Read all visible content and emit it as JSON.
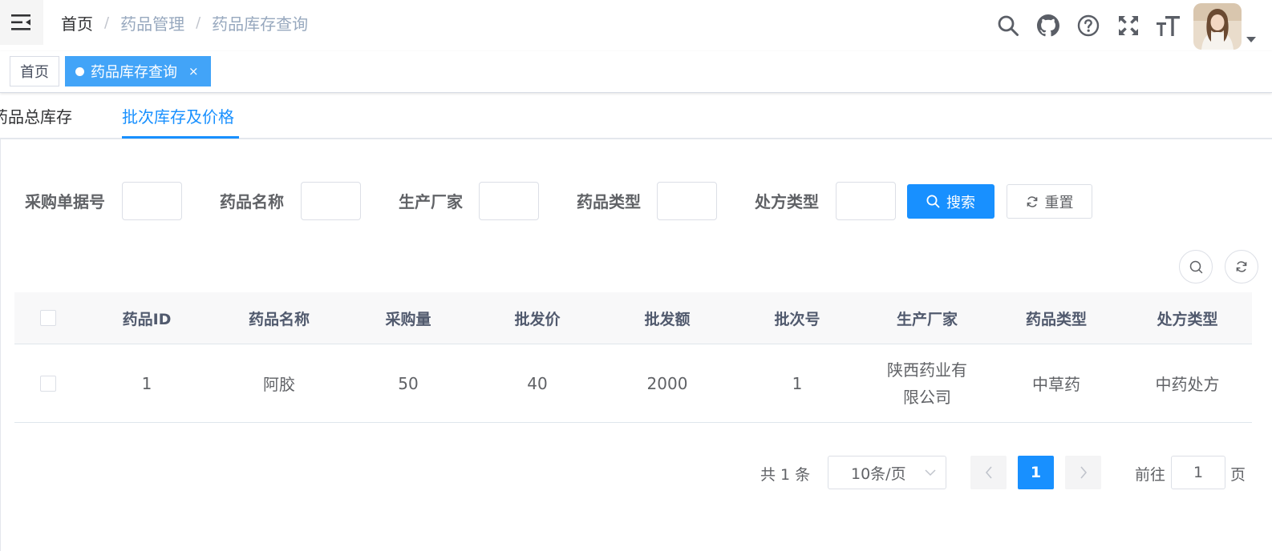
{
  "breadcrumb": [
    "首页",
    "药品管理",
    "药品库存查询"
  ],
  "tags": {
    "home": "首页",
    "active": "药品库存查询",
    "close": "×"
  },
  "tabs": [
    "药品总库存",
    "批次库存及价格"
  ],
  "search_form": {
    "labels": [
      "采购单据号",
      "药品名称",
      "生产厂家",
      "药品类型",
      "处方类型"
    ],
    "values": [
      "",
      "",
      "",
      "",
      ""
    ],
    "search_button": "搜索",
    "reset_button": "重置"
  },
  "table": {
    "headers": [
      "药品ID",
      "药品名称",
      "采购量",
      "批发价",
      "批发额",
      "批次号",
      "生产厂家",
      "药品类型",
      "处方类型"
    ],
    "rows": [
      [
        "1",
        "阿胶",
        "50",
        "40",
        "2000",
        "1",
        "陕西药业有限公司",
        "中草药",
        "中药处方"
      ]
    ]
  },
  "pagination": {
    "total": "共 1 条",
    "page_size": "10条/页",
    "current_page": "1",
    "goto_label": "前往",
    "goto_value": "1",
    "page_suffix": "页"
  },
  "colors": {
    "primary": "#1890ff",
    "tag_active": "#42a4f8"
  },
  "icons": [
    "hamburger-icon",
    "search-icon",
    "github-icon",
    "question-icon",
    "fullscreen-icon",
    "font-size-icon",
    "chevron-down-icon",
    "refresh-icon",
    "chevron-left-icon",
    "chevron-right-icon"
  ]
}
